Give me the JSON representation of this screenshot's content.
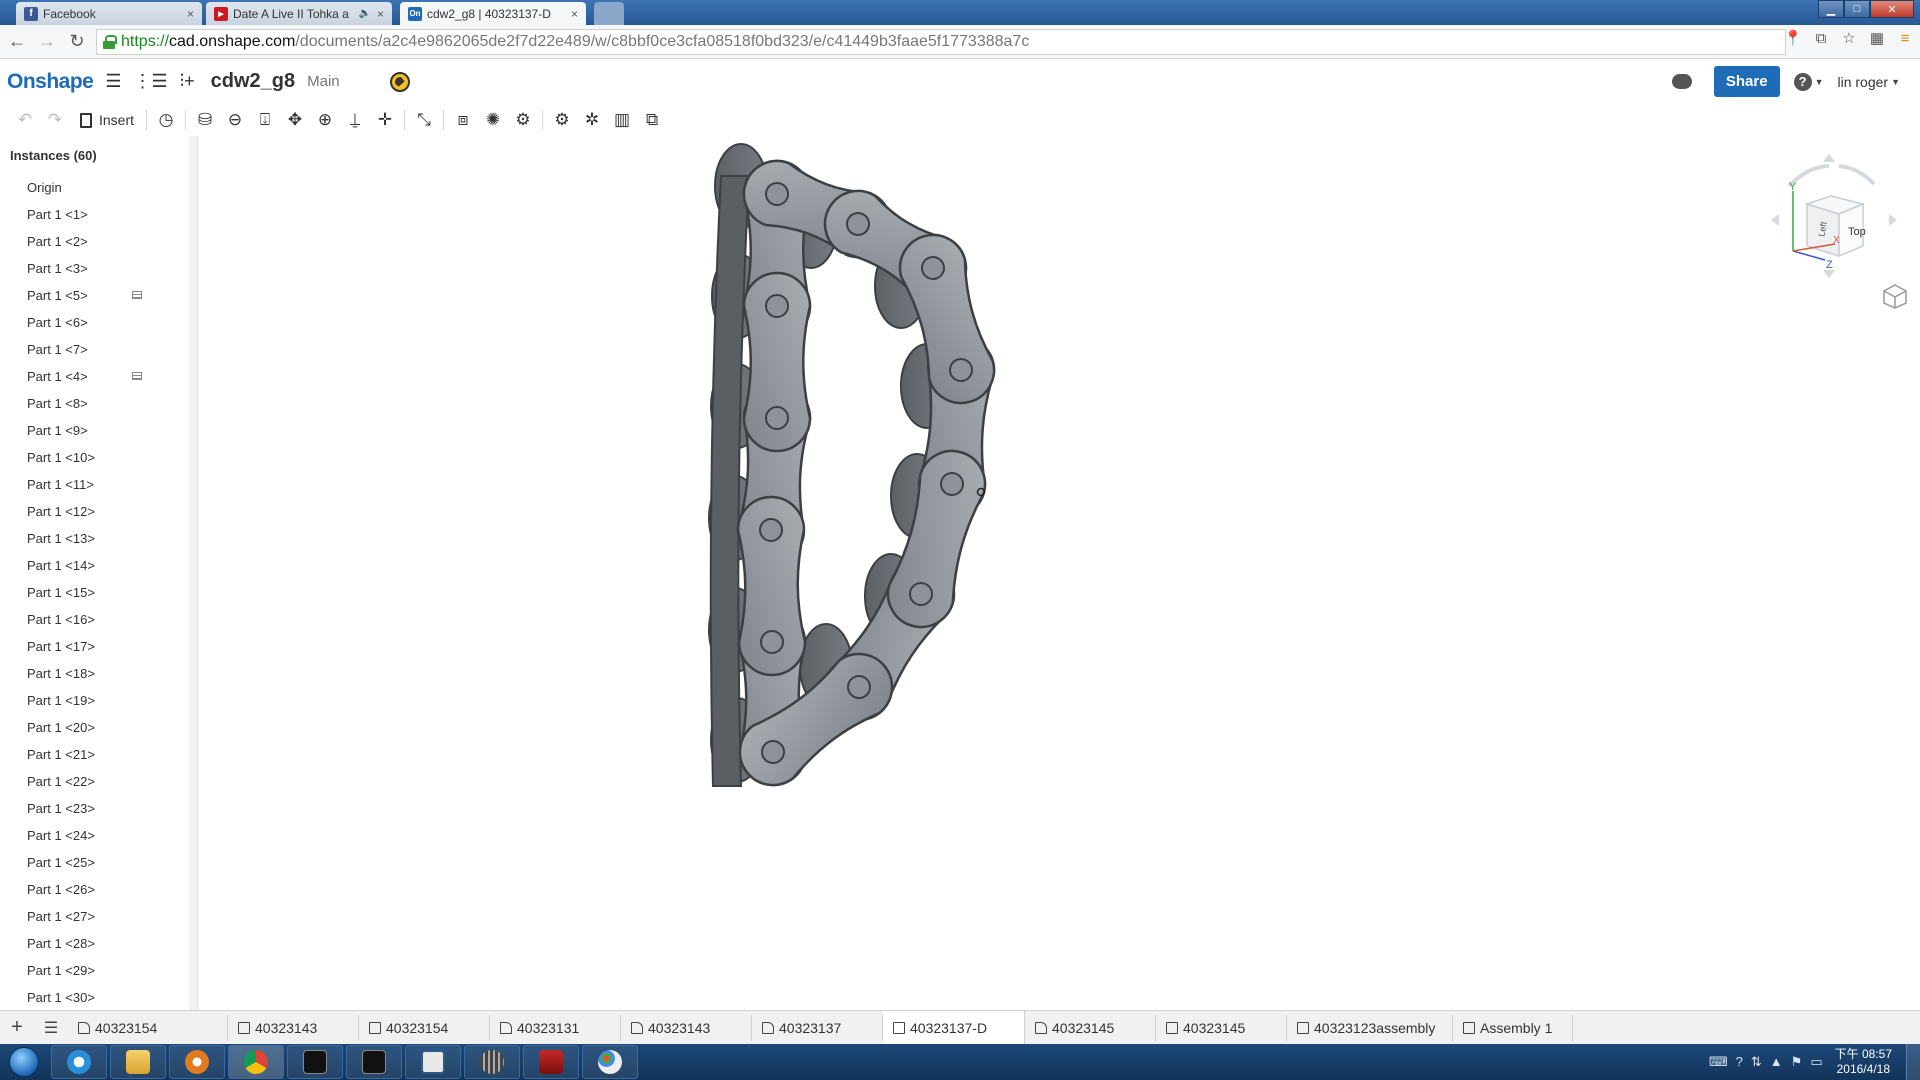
{
  "browser": {
    "tabs": [
      {
        "title": "Facebook",
        "favicon_color": "#3b5998",
        "favicon_glyph": "f",
        "close": "×"
      },
      {
        "title": "Date A Live II Tohka a",
        "favicon_color": "#cc181e",
        "favicon_glyph": "▶",
        "close": "×",
        "audio": "🔈"
      },
      {
        "title": "cdw2_g8 | 40323137-D",
        "favicon_color": "#1e6bb8",
        "favicon_glyph": "On",
        "close": "×",
        "active": true
      }
    ],
    "url": {
      "scheme": "https://",
      "host": "cad.onshape.com",
      "path": "/documents/a2c4e9862065de2f7d22e489/w/c8bbf0ce3cfa08518f0bd323/e/c41449b3faae5f1773388a7c"
    }
  },
  "header": {
    "logo": "Onshape",
    "document_title": "cdw2_g8",
    "branch": "Main",
    "share_label": "Share",
    "help_label": "?",
    "user_name": "lin roger"
  },
  "toolbar": {
    "insert_label": "Insert"
  },
  "instances": {
    "title": "Instances (60)",
    "items": [
      {
        "label": "Origin"
      },
      {
        "label": "Part 1 <1>"
      },
      {
        "label": "Part 1 <2>"
      },
      {
        "label": "Part 1 <3>"
      },
      {
        "label": "Part 1 <5>",
        "mate": true
      },
      {
        "label": "Part 1 <6>"
      },
      {
        "label": "Part 1 <7>"
      },
      {
        "label": "Part 1 <4>",
        "mate": true
      },
      {
        "label": "Part 1 <8>"
      },
      {
        "label": "Part 1 <9>"
      },
      {
        "label": "Part 1 <10>"
      },
      {
        "label": "Part 1 <11>"
      },
      {
        "label": "Part 1 <12>"
      },
      {
        "label": "Part 1 <13>"
      },
      {
        "label": "Part 1 <14>"
      },
      {
        "label": "Part 1 <15>"
      },
      {
        "label": "Part 1 <16>"
      },
      {
        "label": "Part 1 <17>"
      },
      {
        "label": "Part 1 <18>"
      },
      {
        "label": "Part 1 <19>"
      },
      {
        "label": "Part 1 <20>"
      },
      {
        "label": "Part 1 <21>"
      },
      {
        "label": "Part 1 <22>"
      },
      {
        "label": "Part 1 <23>"
      },
      {
        "label": "Part 1 <24>"
      },
      {
        "label": "Part 1 <25>"
      },
      {
        "label": "Part 1 <26>"
      },
      {
        "label": "Part 1 <27>"
      },
      {
        "label": "Part 1 <28>"
      },
      {
        "label": "Part 1 <29>"
      },
      {
        "label": "Part 1 <30>"
      }
    ]
  },
  "viewcube": {
    "axis_y": "Y",
    "axis_z": "Z",
    "axis_x": "X",
    "face_top": "Top",
    "face_left": "Left"
  },
  "bottom_tabs": [
    {
      "label": "40323154",
      "type": "assembly"
    },
    {
      "label": "40323143",
      "type": "partstudio"
    },
    {
      "label": "40323154",
      "type": "partstudio"
    },
    {
      "label": "40323131",
      "type": "assembly"
    },
    {
      "label": "40323143",
      "type": "assembly"
    },
    {
      "label": "40323137",
      "type": "assembly"
    },
    {
      "label": "40323137-D",
      "type": "partstudio",
      "active": true
    },
    {
      "label": "40323145",
      "type": "assembly"
    },
    {
      "label": "40323145",
      "type": "partstudio"
    },
    {
      "label": "40323123assembly",
      "type": "partstudio"
    },
    {
      "label": "Assembly 1",
      "type": "partstudio"
    }
  ],
  "taskbar": {
    "time": "下午 08:57",
    "date": "2016/4/18"
  },
  "colors": {
    "onshape_blue": "#1e6bb8",
    "chain_plate": "#8a9096",
    "chain_edge": "#3c3f43",
    "taskbar": "#12345a"
  }
}
